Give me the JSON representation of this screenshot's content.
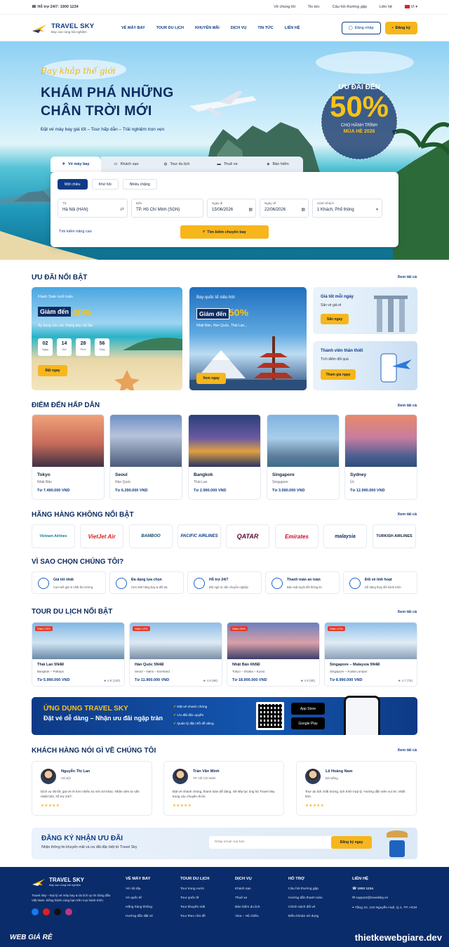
{
  "topbar": {
    "hotline": "Hỗ trợ 24/7: 1900 1234",
    "links": [
      "Về chúng tôi",
      "Tin tức",
      "Câu hỏi thường gặp",
      "Liên hệ"
    ],
    "lang": "VI"
  },
  "header": {
    "brand": "TRAVEL SKY",
    "tagline": "Bay cao cùng trải nghiệm",
    "menu": [
      "VÉ MÁY BAY",
      "TOUR DU LỊCH",
      "KHUYẾN MÃI",
      "DỊCH VỤ",
      "TIN TỨC",
      "LIÊN HỆ"
    ],
    "login": "Đăng nhập",
    "register": "Đăng ký"
  },
  "hero": {
    "slogan": "Bay khắp thế giới",
    "title1": "KHÁM PHÁ NHỮNG",
    "title2": "CHÂN TRỜI MỚI",
    "sub": "Đặt vé máy bay giá tốt – Tour hấp dẫn – Trải nghiệm trọn vẹn",
    "badge_a": "ƯU ĐÃI ĐẾN",
    "badge_b": "50%",
    "badge_c": "CHO HÀNH TRÌNH",
    "badge_d": "MÙA HÈ 2026"
  },
  "search": {
    "tabs": [
      "Vé máy bay",
      "Khách sạn",
      "Tour du lịch",
      "Thuê xe",
      "Bảo hiểm"
    ],
    "trip": [
      "Một chiều",
      "Khứ hồi",
      "Nhiều chặng"
    ],
    "fields": [
      {
        "l": "Từ",
        "v": "Hà Nội (HAN)"
      },
      {
        "l": "Đến",
        "v": "TP. Hồ Chí Minh (SGN)"
      },
      {
        "l": "Ngày đi",
        "v": "15/06/2026"
      },
      {
        "l": "Ngày về",
        "v": "22/06/2026"
      },
      {
        "l": "Hành khách",
        "v": "1 Khách, Phổ thông"
      }
    ],
    "advanced": "Tìm kiếm nâng cao",
    "button": "Tìm kiếm chuyến bay"
  },
  "deals": {
    "title": "ƯU ĐÃI NỔI BẬT",
    "see": "Xem tất cả",
    "d1": {
      "k": "Flash Sale cuối tuần",
      "g": "Giảm đến",
      "p": "40%",
      "s": "Áp dụng cho các chặng bay nội địa",
      "cd": [
        {
          "n": "02",
          "u": "Ngày"
        },
        {
          "n": "14",
          "u": "Giờ"
        },
        {
          "n": "28",
          "u": "Phút"
        },
        {
          "n": "56",
          "u": "Giây"
        }
      ],
      "btn": "Đặt ngay"
    },
    "d2": {
      "k": "Bay quốc tế siêu hời",
      "g": "Giảm đến",
      "p": "50%",
      "s": "Nhật Bản, Hàn Quốc, Thái Lan...",
      "btn": "Xem ngay"
    },
    "d3": {
      "k": "Giá tốt mỗi ngày",
      "s": "Săn vé giá rẻ",
      "btn": "Săn ngay"
    },
    "d4": {
      "k": "Thành viên thân thiết",
      "s": "Tích điểm đổi quà",
      "btn": "Tham gia ngay"
    }
  },
  "dest": {
    "title": "ĐIỂM ĐẾN HẤP DẪN",
    "see": "Xem tất cả",
    "items": [
      {
        "n": "Tokyo",
        "c": "Nhật Bản",
        "p": "Từ 7.490.000 VND"
      },
      {
        "n": "Seoul",
        "c": "Hàn Quốc",
        "p": "Từ 6.290.000 VND"
      },
      {
        "n": "Bangkok",
        "c": "Thái Lan",
        "p": "Từ 2.990.000 VND"
      },
      {
        "n": "Singapore",
        "c": "Singapore",
        "p": "Từ 3.590.000 VND"
      },
      {
        "n": "Sydney",
        "c": "Úc",
        "p": "Từ 12.990.000 VND"
      }
    ]
  },
  "airlines": {
    "title": "HÃNG HÀNG KHÔNG NỔI BẬT",
    "see": "Xem tất cả",
    "items": [
      "Vietnam Airlines",
      "VietJet Air",
      "BAMBOO",
      "PACIFIC AIRLINES",
      "QATAR",
      "Emirates",
      "malaysia",
      "TURKISH AIRLINES"
    ]
  },
  "why": {
    "title": "VÌ SAO CHỌN CHÚNG TÔI?",
    "items": [
      {
        "t": "Giá tốt nhất",
        "d": "Cam kết giá rẻ nhất thị trường"
      },
      {
        "t": "Đa dạng lựa chọn",
        "d": "Hơn 500 hãng bay & đối tác"
      },
      {
        "t": "Hỗ trợ 24/7",
        "d": "Đội ngũ tư vấn chuyên nghiệp"
      },
      {
        "t": "Thanh toán an toàn",
        "d": "Bảo mật tuyệt đối thông tin"
      },
      {
        "t": "Đổi vé linh hoạt",
        "d": "Dễ dàng thay đổi hành trình"
      }
    ]
  },
  "tours": {
    "title": "TOUR DU LỊCH NỔI BẬT",
    "see": "Xem tất cả",
    "items": [
      {
        "b": "Giảm 15%",
        "n": "Thái Lan 5N4Đ",
        "r": "Bangkok – Pattaya",
        "p": "Từ 5.990.000 VND",
        "s": "★ 4.8 (120)"
      },
      {
        "b": "Giảm 10%",
        "n": "Hàn Quốc 5N4Đ",
        "r": "Seoul – Nami – Everland",
        "p": "Từ 11.900.000 VND",
        "s": "★ 4.9 (98)"
      },
      {
        "b": "Giảm 20%",
        "n": "Nhật Bản 6N5Đ",
        "r": "Tokyo – Osaka – Kyoto",
        "p": "Từ 18.900.000 VND",
        "s": "★ 4.9 (85)"
      },
      {
        "b": "Giảm 10%",
        "n": "Singapore – Malaysia 5N4Đ",
        "r": "Singapore – Kuala Lumpur",
        "p": "Từ 8.990.000 VND",
        "s": "★ 4.7 (76)"
      }
    ]
  },
  "app": {
    "t1": "ỨNG DỤNG TRAVEL SKY",
    "t2": "Đặt vé dễ dàng – Nhận ưu đãi ngập tràn",
    "f": [
      "Đặt vé nhanh chóng",
      "Ưu đãi độc quyền",
      "Quản lý đặt chỗ dễ dàng"
    ],
    "store1": "App Store",
    "store2": "Google Play"
  },
  "testi": {
    "title": "KHÁCH HÀNG NÓI GÌ VỀ CHÚNG TÔI",
    "see": "Xem tất cả",
    "items": [
      {
        "n": "Nguyễn Thị Lan",
        "c": "Hà Nội",
        "q": "Dịch vụ rất tốt, giá vé rẻ hơn nhiều so với nơi khác. Nhân viên tư vấn nhiệt tình, hỗ trợ 24/7.",
        "s": "★★★★★"
      },
      {
        "n": "Trần Văn Minh",
        "c": "TP. Hồ Chí Minh",
        "q": "Đặt vé nhanh chóng, thanh toán dễ dàng. Sẽ tiếp tục ủng hộ Travel Sky trong các chuyến đi tới.",
        "s": "★★★★★"
      },
      {
        "n": "Lê Hoàng Nam",
        "c": "Đà Nẵng",
        "q": "Tour du lịch chất lượng, lịch trình hợp lý. Hướng dẫn viên vui vẻ, nhiệt tình.",
        "s": "★★★★★"
      }
    ]
  },
  "newsletter": {
    "t1": "ĐĂNG KÝ NHẬN ƯU ĐÃI",
    "t2": "Nhận thông tin khuyến mãi và ưu đãi đặc biệt từ Travel Sky",
    "placeholder": "Nhập email của bạn",
    "btn": "Đăng ký ngay"
  },
  "footer": {
    "brand": "TRAVEL SKY",
    "tagline": "Bay cao cùng trải nghiệm",
    "about": "Travel Sky – Đại lý vé máy bay & du lịch uy tín hàng đầu Việt Nam. Đồng hành cùng bạn trên mọi hành trình.",
    "cols": [
      {
        "h": "VÉ MÁY BAY",
        "i": [
          "Vé nội địa",
          "Vé quốc tế",
          "Hãng hàng không",
          "Hướng dẫn đặt vé"
        ]
      },
      {
        "h": "TOUR DU LỊCH",
        "i": [
          "Tour trong nước",
          "Tour quốc tế",
          "Tour khuyến mãi",
          "Tour theo chủ đề"
        ]
      },
      {
        "h": "DỊCH VỤ",
        "i": [
          "Khách sạn",
          "Thuê xe",
          "Bảo hiểm du lịch",
          "Visa – Hộ chiếu"
        ]
      },
      {
        "h": "HỖ TRỢ",
        "i": [
          "Câu hỏi thường gặp",
          "Hướng dẫn thanh toán",
          "Chính sách đổi vé",
          "Điều khoản sử dụng"
        ]
      },
      {
        "h": "LIÊN HỆ",
        "i": [
          "1900 1234",
          "support@travelsky.vn",
          "Tầng 10, 123 Nguyễn Huệ, Q.1, TP. HCM"
        ]
      }
    ],
    "watermark": "thietkewebgiare.dev",
    "wm2": "WEB GIÁ RẺ"
  }
}
